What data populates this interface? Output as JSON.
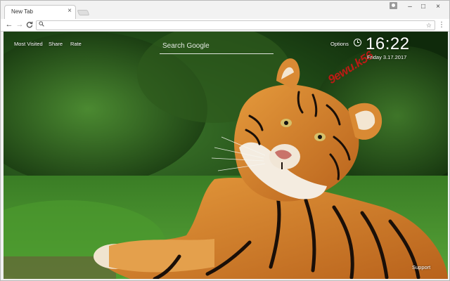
{
  "browser": {
    "tab_title": "New Tab",
    "tab_close": "×",
    "window_controls": {
      "minimize": "–",
      "maximize": "□",
      "close": "×"
    },
    "nav": {
      "back": "←",
      "forward": "→",
      "reload": "C"
    },
    "address_value": "",
    "icons": [
      "profile-icon",
      "search-icon",
      "star-icon",
      "menu-icon"
    ]
  },
  "newtab": {
    "links": {
      "most_visited": "Most Visited",
      "share": "Share",
      "rate": "Rate"
    },
    "search": {
      "placeholder": "Search Google",
      "value": ""
    },
    "options": "Options",
    "clock": {
      "time": "16:22",
      "date": "Friday  3.17.2017"
    },
    "watermark": "9ewu.k56",
    "support": "Support"
  },
  "colors": {
    "watermark": "#d21414",
    "grass": "#3f8a2a",
    "tiger_orange": "#d9822b"
  }
}
